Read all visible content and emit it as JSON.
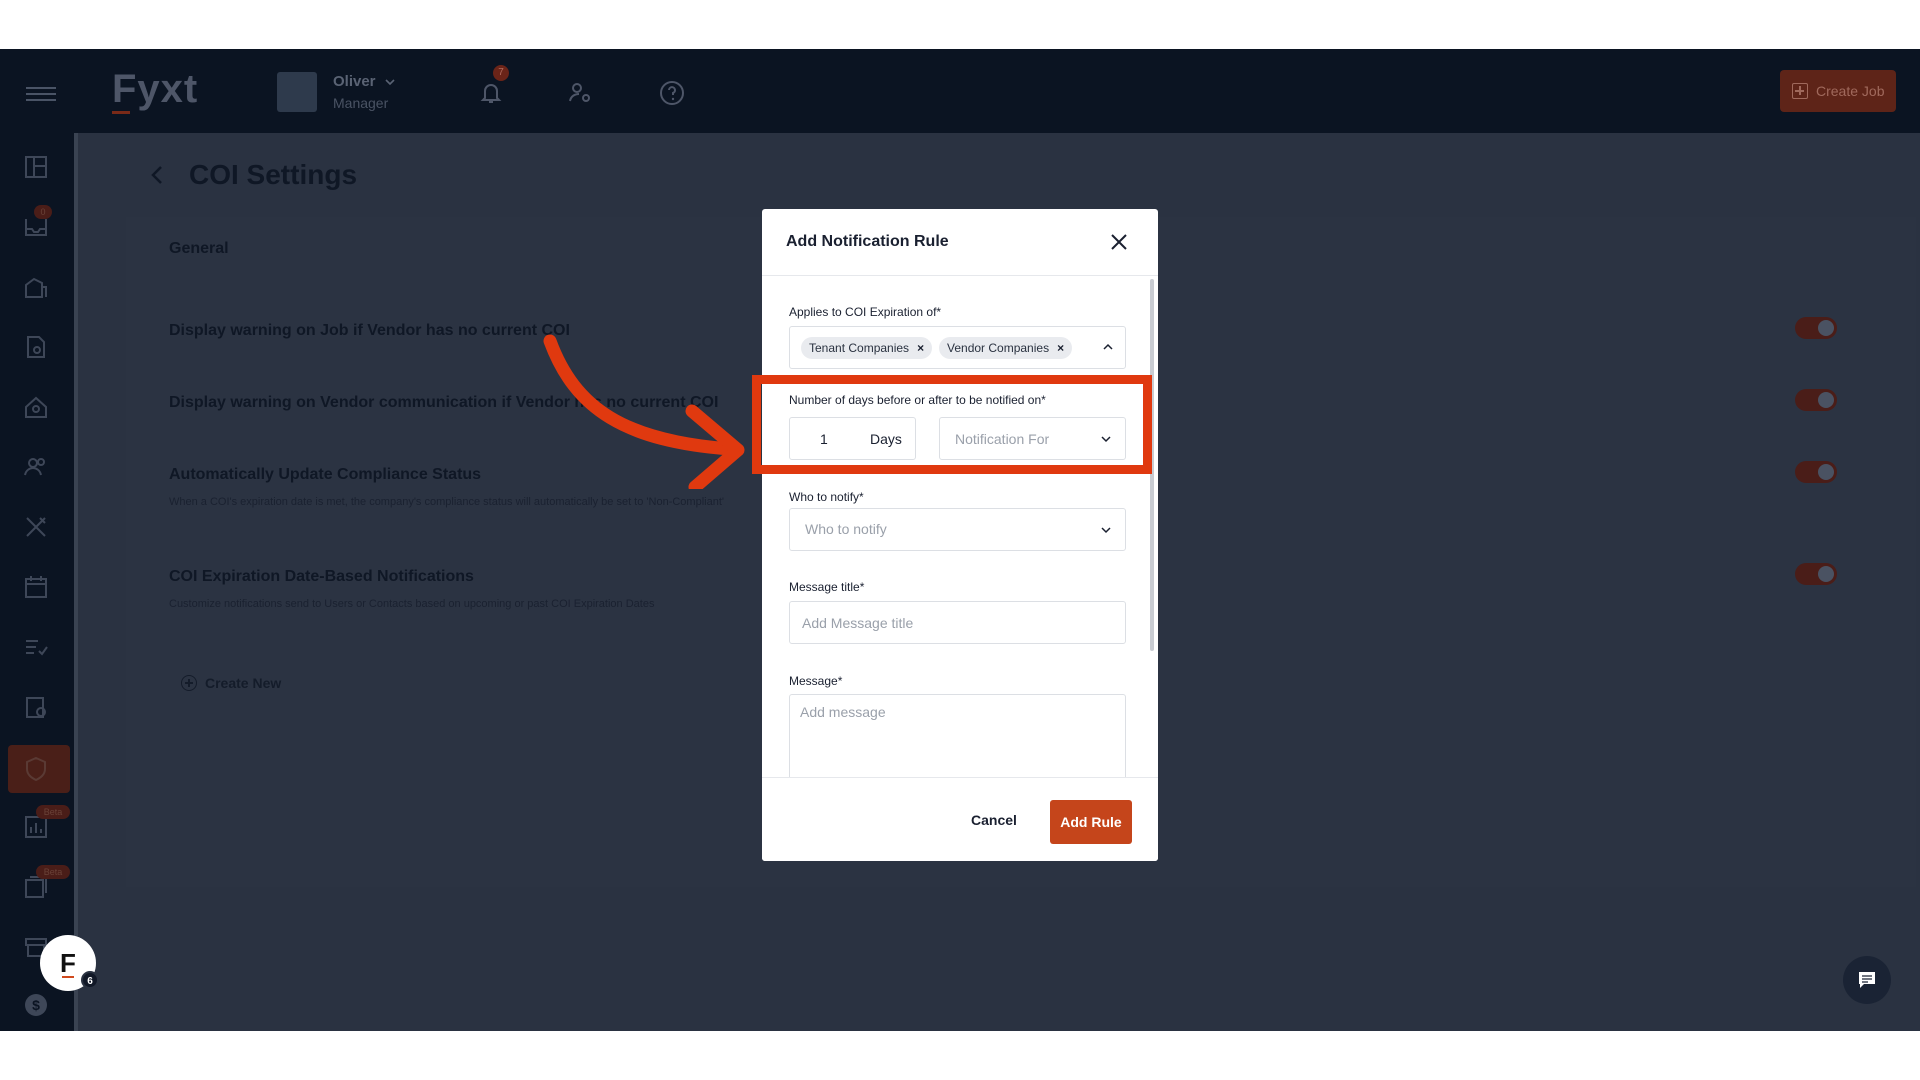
{
  "topbar": {
    "logo": "Fyxt",
    "user_name": "Oliver",
    "user_role": "Manager",
    "bell_badge": "7",
    "create_job_label": "Create Job"
  },
  "sidebar": {
    "inbox_badge": "0",
    "beta_label_1": "Beta",
    "beta_label_2": "Beta",
    "items": [
      "dashboard",
      "inbox",
      "properties",
      "documents",
      "tenants",
      "contacts",
      "vendors",
      "schedule",
      "tasks",
      "reports",
      "coi",
      "analytics",
      "media",
      "archive",
      "billing"
    ]
  },
  "page": {
    "title": "COI Settings",
    "section": "General",
    "settings": [
      {
        "title": "Display warning on Job if Vendor has no current COI",
        "desc": ""
      },
      {
        "title": "Display warning on Vendor communication if Vendor has no current COI",
        "desc": ""
      },
      {
        "title": "Automatically Update Compliance Status",
        "desc": "When a COI's expiration date is met, the company's compliance status will automatically be set to 'Non-Compliant'"
      },
      {
        "title": "COI Expiration Date-Based Notifications",
        "desc": "Customize notifications send to Users or Contacts based on upcoming or past COI Expiration Dates"
      }
    ],
    "create_new_label": "Create New"
  },
  "modal": {
    "title": "Add Notification Rule",
    "applies_label": "Applies to COI Expiration of*",
    "chips": [
      "Tenant Companies",
      "Vendor Companies"
    ],
    "days_label": "Number of days before or after to be notified on*",
    "days_value": "1",
    "days_unit": "Days",
    "notification_for_placeholder": "Notification For",
    "who_label": "Who to notify*",
    "who_placeholder": "Who to notify",
    "message_title_label": "Message title*",
    "message_title_placeholder": "Add Message title",
    "message_label": "Message*",
    "message_placeholder": "Add message",
    "cancel_label": "Cancel",
    "add_rule_label": "Add Rule"
  },
  "floating": {
    "avatar_letter": "F",
    "avatar_count": "6"
  },
  "colors": {
    "accent": "#c5451b",
    "annotation": "#e0390f",
    "topbar_bg": "#0b1422"
  }
}
